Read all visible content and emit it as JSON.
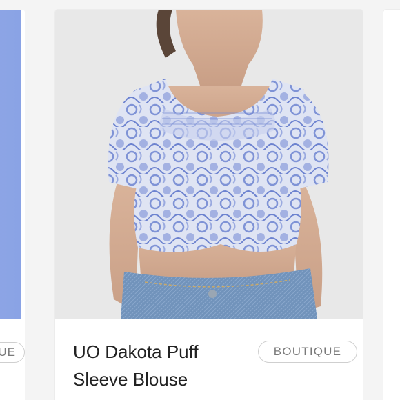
{
  "prev_card": {
    "badge_label": "UE",
    "image_alt": "partial product photo"
  },
  "product_card": {
    "image_alt": "Model wearing a blue and white printed cropped puff sleeve blouse with jeans",
    "title": "UO Dakota Puff Sleeve Blouse",
    "badge_label": "BOUTIQUE"
  },
  "next_card": {
    "image_alt": "partial next product card"
  },
  "colors": {
    "background": "#f4f4f4",
    "card": "#ffffff",
    "badge_border": "#cfcfcf",
    "badge_text": "#7a7a7a",
    "title_text": "#222222",
    "blouse_blue": "#7f93d6",
    "denim": "#6f8fb5"
  }
}
